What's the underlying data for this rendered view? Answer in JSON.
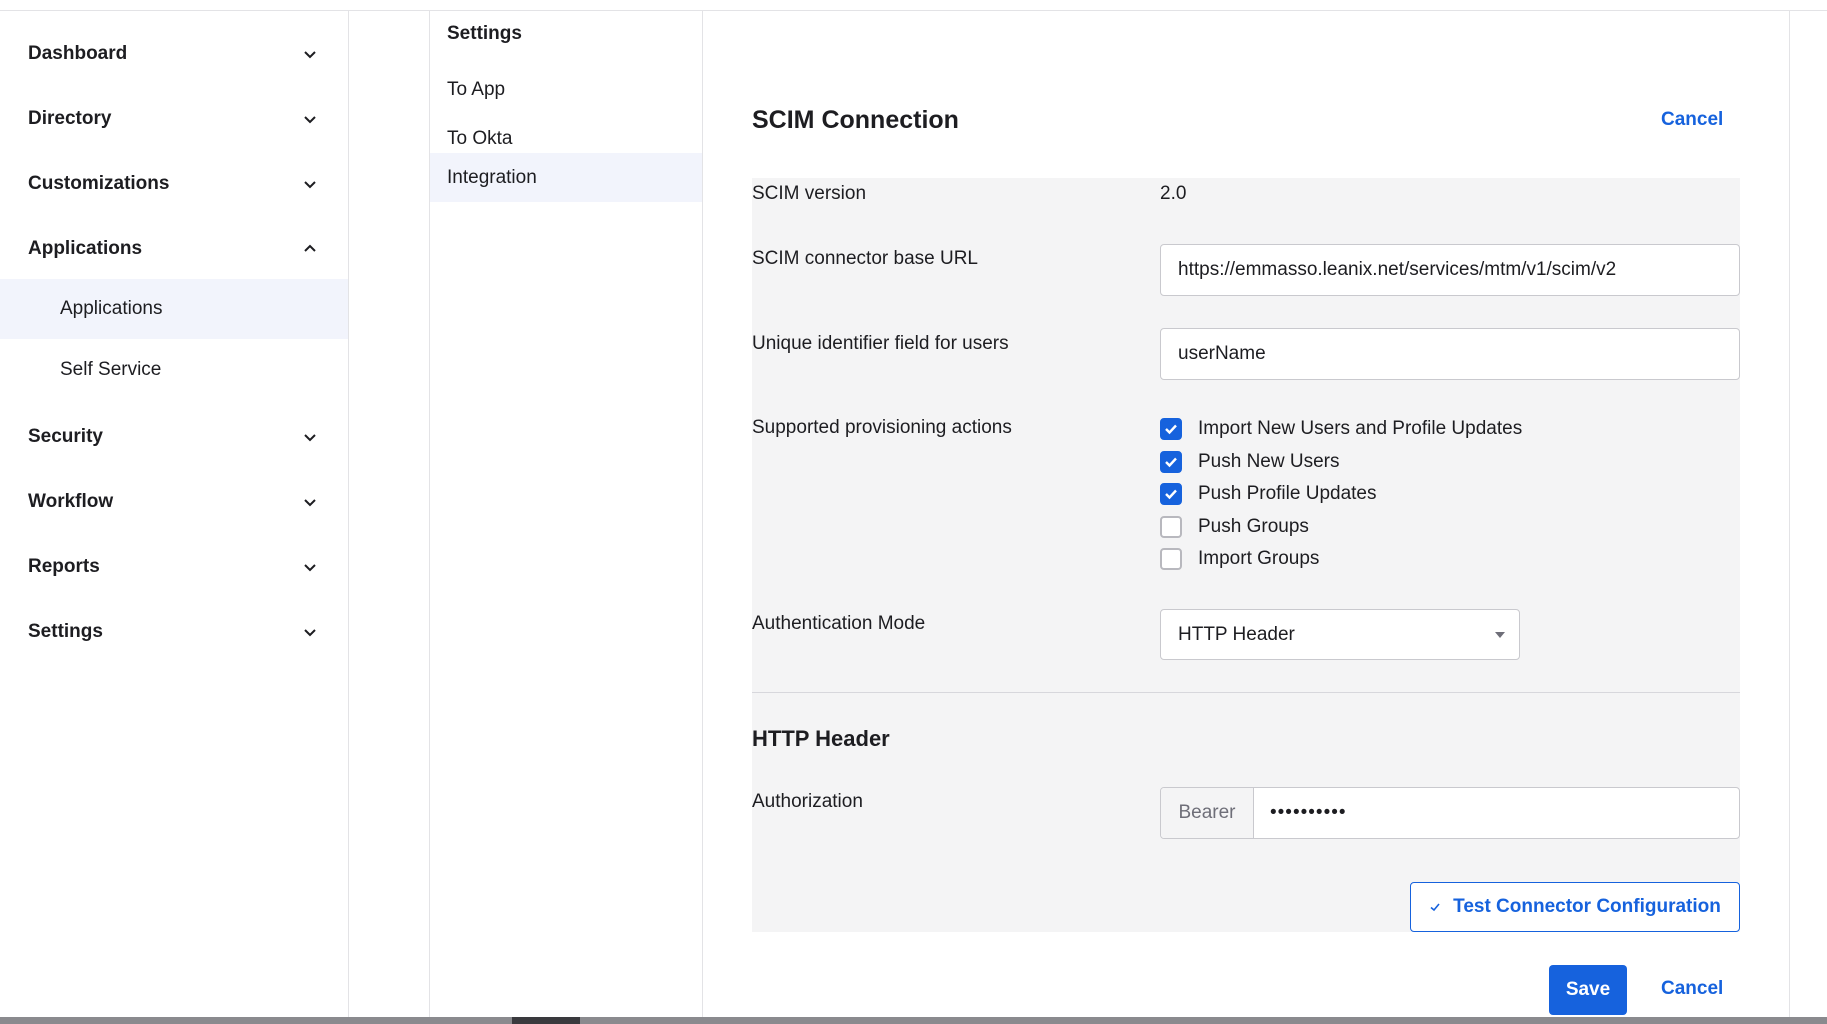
{
  "sidebar": {
    "items": [
      {
        "label": "Dashboard",
        "chevron": "chevron-down-icon"
      },
      {
        "label": "Directory",
        "chevron": "chevron-down-icon"
      },
      {
        "label": "Customizations",
        "chevron": "chevron-down-icon"
      },
      {
        "label": "Applications",
        "chevron": "chevron-up-icon"
      },
      {
        "label": "Security",
        "chevron": "chevron-down-icon"
      },
      {
        "label": "Workflow",
        "chevron": "chevron-down-icon"
      },
      {
        "label": "Reports",
        "chevron": "chevron-down-icon"
      },
      {
        "label": "Settings",
        "chevron": "chevron-down-icon"
      }
    ],
    "subitems": [
      {
        "label": "Applications",
        "active": true
      },
      {
        "label": "Self Service",
        "active": false
      }
    ]
  },
  "settings_nav": {
    "title": "Settings",
    "links": [
      {
        "label": "To App",
        "active": false
      },
      {
        "label": "To Okta",
        "active": false
      },
      {
        "label": "Integration",
        "active": true
      }
    ]
  },
  "scim": {
    "title": "SCIM Connection",
    "cancel_top": "Cancel",
    "version_label": "SCIM version",
    "version_value": "2.0",
    "base_url_label": "SCIM connector base URL",
    "base_url_value": "https://emmasso.leanix.net/services/mtm/v1/scim/v2",
    "unique_id_label": "Unique identifier field for users",
    "unique_id_value": "userName",
    "provisioning_label": "Supported provisioning actions",
    "provisioning_actions": [
      {
        "label": "Import New Users and Profile Updates",
        "checked": true
      },
      {
        "label": "Push New Users",
        "checked": true
      },
      {
        "label": "Push Profile Updates",
        "checked": true
      },
      {
        "label": "Push Groups",
        "checked": false
      },
      {
        "label": "Import Groups",
        "checked": false
      }
    ],
    "auth_mode_label": "Authentication Mode",
    "auth_mode_value": "HTTP Header"
  },
  "http_header": {
    "title": "HTTP Header",
    "authorization_label": "Authorization",
    "authorization_prefix": "Bearer",
    "authorization_value": "••••••••••",
    "test_button": "Test Connector Configuration"
  },
  "footer": {
    "save_label": "Save",
    "cancel_label": "Cancel"
  },
  "colors": {
    "accent": "#1662dd",
    "panel_bg": "#f4f4f5",
    "active_nav_bg": "#f2f4fc"
  }
}
